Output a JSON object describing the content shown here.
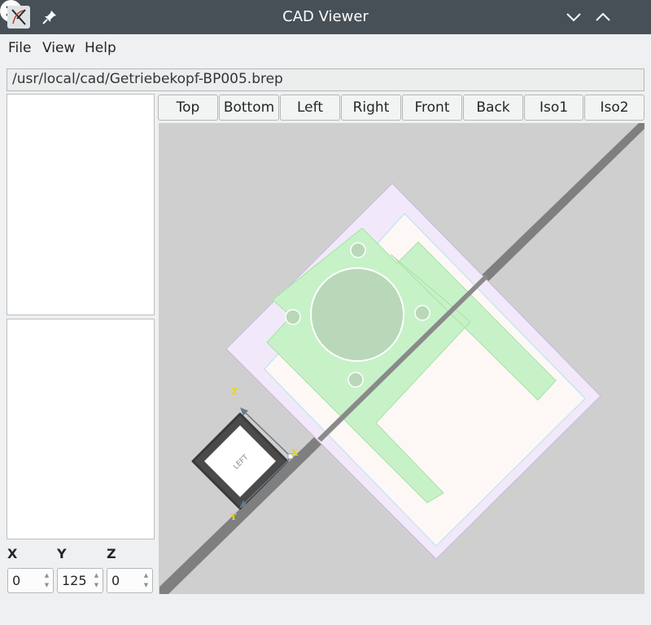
{
  "window": {
    "title": "CAD Viewer",
    "app_icon": "cad-app-icon",
    "pin_icon": "pin-icon",
    "minimize_icon": "chevron-down-icon",
    "maximize_icon": "chevron-up-icon",
    "close_icon": "close-icon"
  },
  "menu": {
    "items": [
      {
        "label": "File"
      },
      {
        "label": "View"
      },
      {
        "label": "Help"
      }
    ]
  },
  "file_path": "/usr/local/cad/Getriebekopf-BP005.brep",
  "views": [
    {
      "label": "Top"
    },
    {
      "label": "Bottom"
    },
    {
      "label": "Left"
    },
    {
      "label": "Right"
    },
    {
      "label": "Front"
    },
    {
      "label": "Back"
    },
    {
      "label": "Iso1"
    },
    {
      "label": "Iso2"
    }
  ],
  "coordinates": {
    "x": {
      "label": "X",
      "value": "0"
    },
    "y": {
      "label": "Y",
      "value": "125"
    },
    "z": {
      "label": "Z",
      "value": "0"
    }
  },
  "viewcube": {
    "face_label": "LEFT",
    "axis_labels": {
      "z": "Z",
      "x": "X",
      "y": "Y"
    }
  },
  "colors": {
    "titlebar": "#475057",
    "viewport_bg": "#cfcfcf",
    "part_outer": "#f1e9f9",
    "part_green": "#c7f2c7",
    "part_white": "#fdf8f5"
  }
}
